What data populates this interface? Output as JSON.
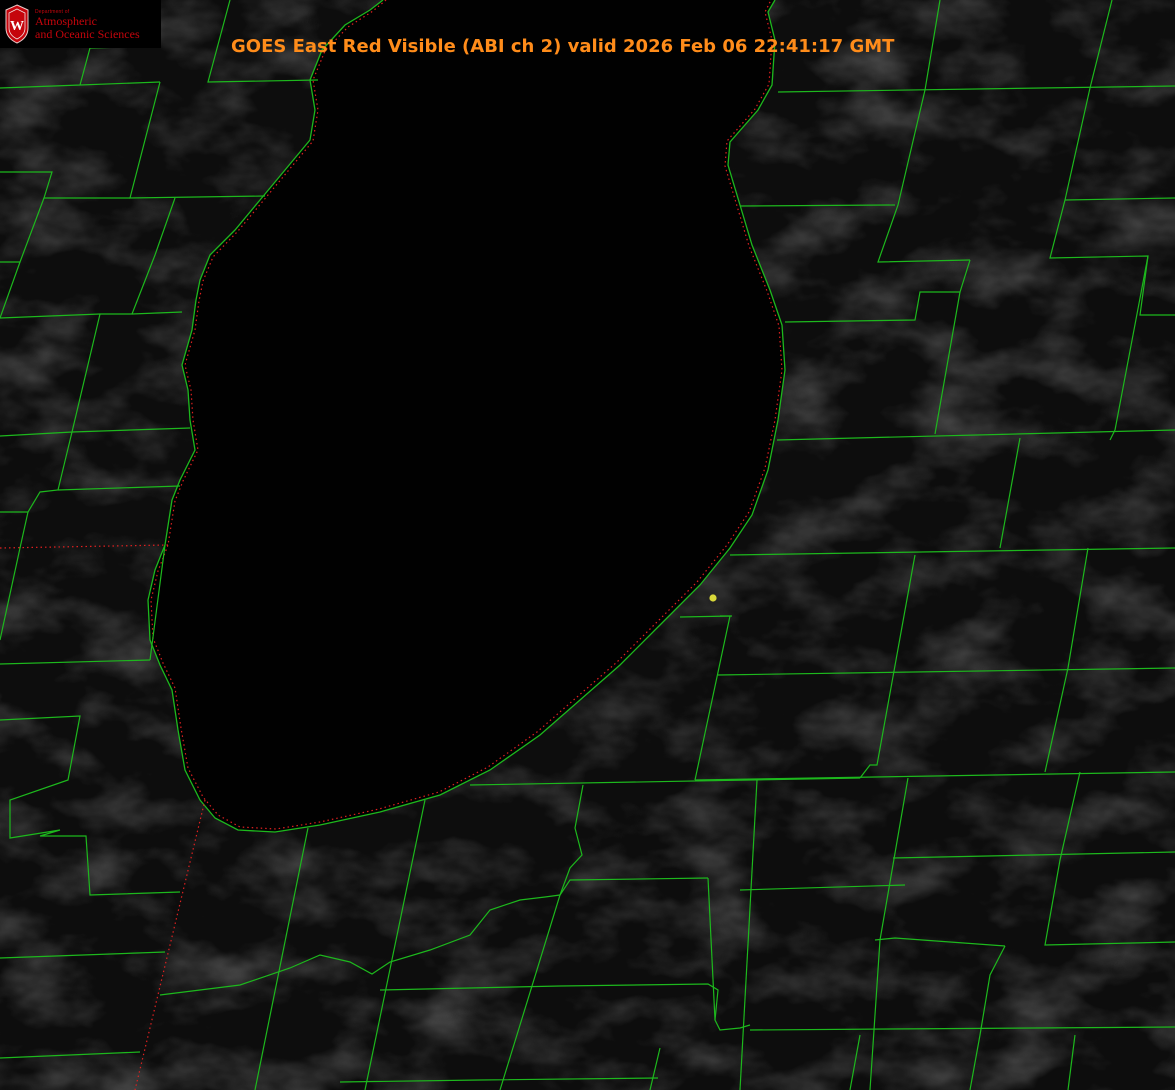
{
  "title": "GOES East Red Visible (ABI ch 2) valid 2026 Feb 06 22:41:17 GMT",
  "logo": {
    "line0": "Department of",
    "line1": "Atmospheric",
    "line2": "and Oceanic Sciences",
    "letter": "W"
  },
  "colors": {
    "background": "#0d0d0d",
    "lake": "#010101",
    "county_lines": "#1db81d",
    "state_border": "#e02020",
    "title": "#ff8c1a",
    "marker": "#d8d83a",
    "logo_red": "#c5050c"
  },
  "map": {
    "type": "satellite-visible-image",
    "features": [
      "lake-michigan-shoreline",
      "county-boundaries",
      "state-boundaries",
      "station-marker"
    ]
  }
}
